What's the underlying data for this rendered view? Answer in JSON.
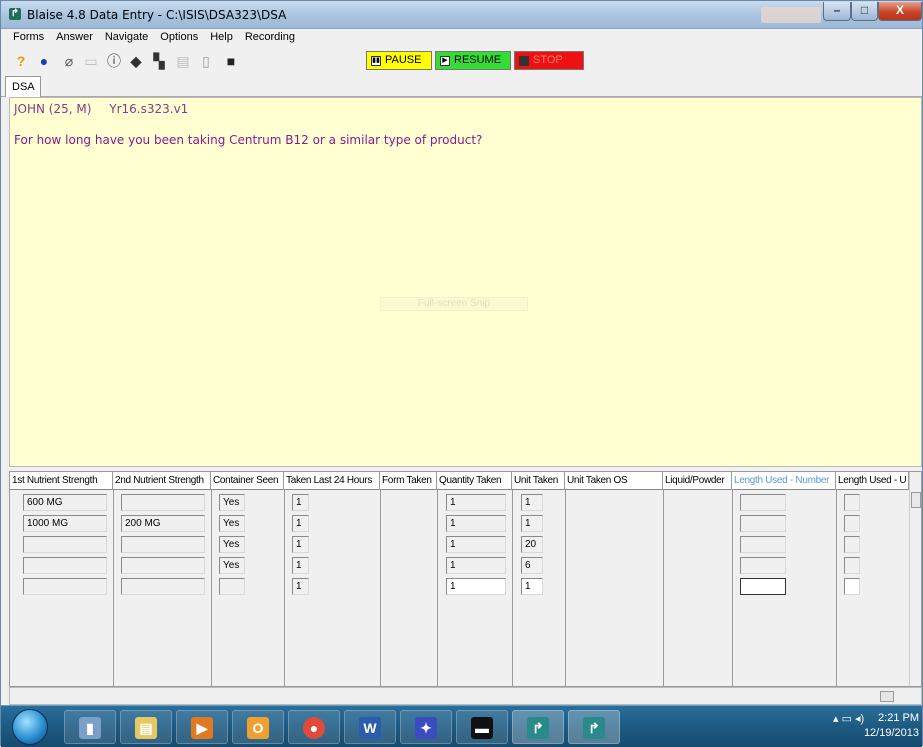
{
  "window": {
    "title": "Blaise 4.8 Data Entry - C:\\ISIS\\DSA323\\DSA",
    "controls": {
      "minimize": "–",
      "maximize": "□",
      "close": "X"
    }
  },
  "menu": [
    "Forms",
    "Answer",
    "Navigate",
    "Options",
    "Help",
    "Recording"
  ],
  "toolbar": {
    "icons": [
      "help-icon",
      "info-exclaim-icon",
      "paperclip-icon",
      "document-icon",
      "info-icon",
      "tag-icon",
      "binoculars-icon",
      "copy-icon",
      "new-page-icon",
      "save-icon"
    ],
    "recording": {
      "pause": "PAUSE",
      "resume": "RESUME",
      "stop": "STOP"
    },
    "recording_colors": {
      "pause": "#ffff00",
      "resume": "#33dd33",
      "stop": "#ee1111"
    }
  },
  "tab": {
    "label": "DSA"
  },
  "question_panel": {
    "respondent": "JOHN (25, M)",
    "field_id": "Yr16.s323.v1",
    "question_text": "For how long have you been taking Centrum B12 or a similar type of product?",
    "overlay": "Full-screen Snip"
  },
  "grid": {
    "columns": [
      "1st Nutrient Strength",
      "2nd Nutrient Strength",
      "Container Seen",
      "Taken Last 24 Hours",
      "Form Taken",
      "Quantity Taken",
      "Unit Taken",
      "Unit Taken OS",
      "Liquid/Powder",
      "Length Used - Number",
      "Length Used - U"
    ],
    "rows": [
      {
        "nut1": "600 MG",
        "nut2": "",
        "seen": "Yes",
        "last24": "1",
        "qty": "1",
        "unit": "1"
      },
      {
        "nut1": "1000 MG",
        "nut2": "200 MG",
        "seen": "Yes",
        "last24": "1",
        "qty": "1",
        "unit": "1"
      },
      {
        "nut1": "",
        "nut2": "",
        "seen": "Yes",
        "last24": "1",
        "qty": "1",
        "unit": "20"
      },
      {
        "nut1": "",
        "nut2": "",
        "seen": "Yes",
        "last24": "1",
        "qty": "1",
        "unit": "6"
      },
      {
        "nut1": "",
        "nut2": "",
        "seen": "",
        "last24": "1",
        "qty": "1",
        "unit": "1"
      }
    ]
  },
  "taskbar": {
    "apps": [
      "explorer-window-icon",
      "file-manager-icon",
      "media-player-icon",
      "outlook-icon",
      "chrome-icon",
      "word-icon",
      "paint-icon",
      "console-icon",
      "blaise-icon",
      "blaise-icon"
    ],
    "clock_time": "2:21 PM",
    "clock_date": "12/19/2013"
  }
}
